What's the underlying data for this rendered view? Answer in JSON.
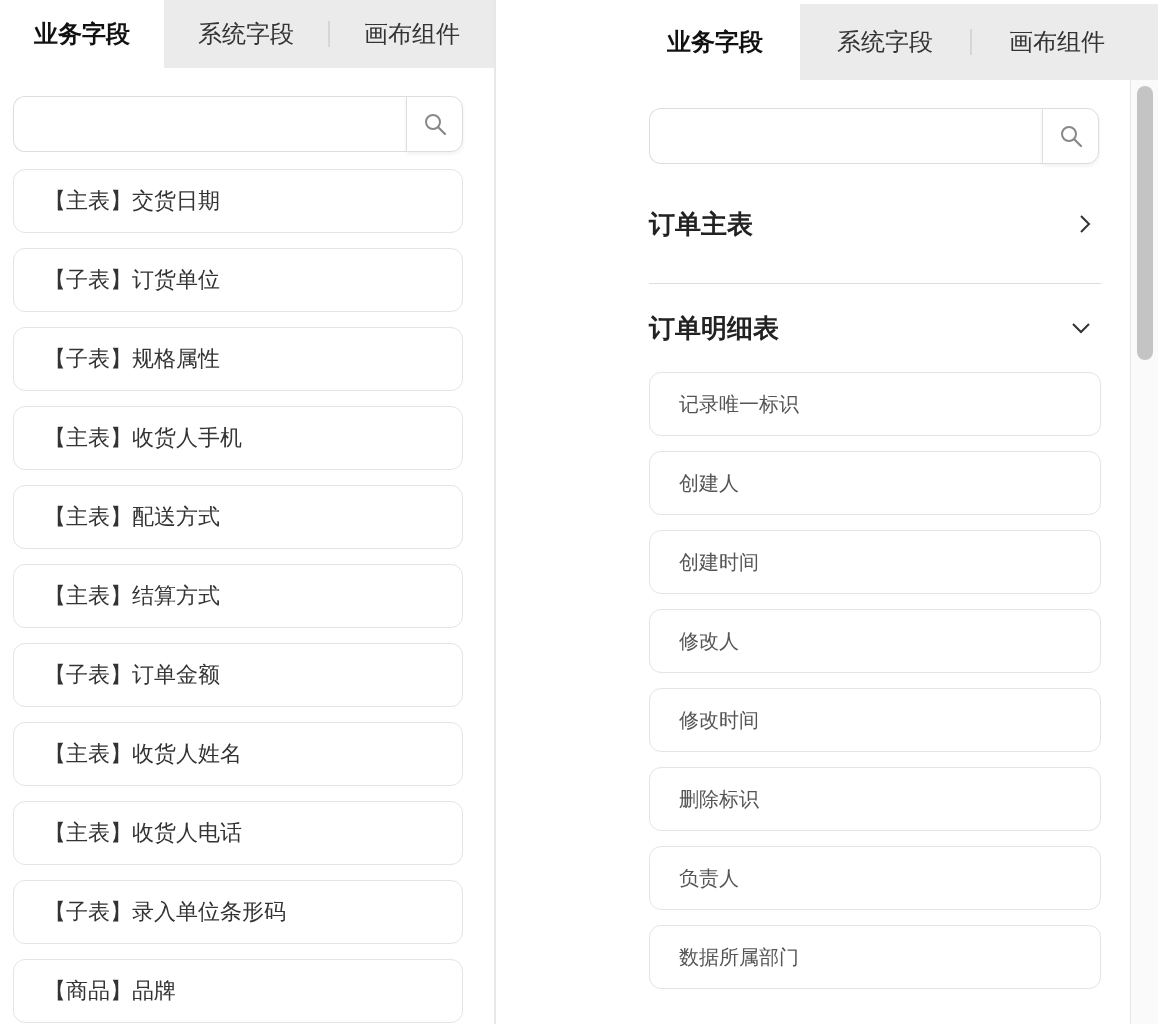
{
  "panels": [
    {
      "tabs": [
        {
          "label": "业务字段",
          "selected": true
        },
        {
          "label": "系统字段",
          "selected": false
        },
        {
          "label": "画布组件",
          "selected": false
        }
      ],
      "items": [
        "【主表】交货日期",
        "【子表】订货单位",
        "【子表】规格属性",
        "【主表】收货人手机",
        "【主表】配送方式",
        "【主表】结算方式",
        "【子表】订单金额",
        "【主表】收货人姓名",
        "【主表】收货人电话",
        "【子表】录入单位条形码",
        "【商品】品牌"
      ]
    },
    {
      "tabs": [
        {
          "label": "业务字段",
          "selected": true
        },
        {
          "label": "系统字段",
          "selected": false
        },
        {
          "label": "画布组件",
          "selected": false
        }
      ],
      "groups": [
        {
          "title": "订单主表",
          "expanded": false
        },
        {
          "title": "订单明细表",
          "expanded": true,
          "items": [
            "记录唯一标识",
            "创建人",
            "创建时间",
            "修改人",
            "修改时间",
            "删除标识",
            "负责人",
            "数据所属部门"
          ]
        }
      ]
    }
  ]
}
